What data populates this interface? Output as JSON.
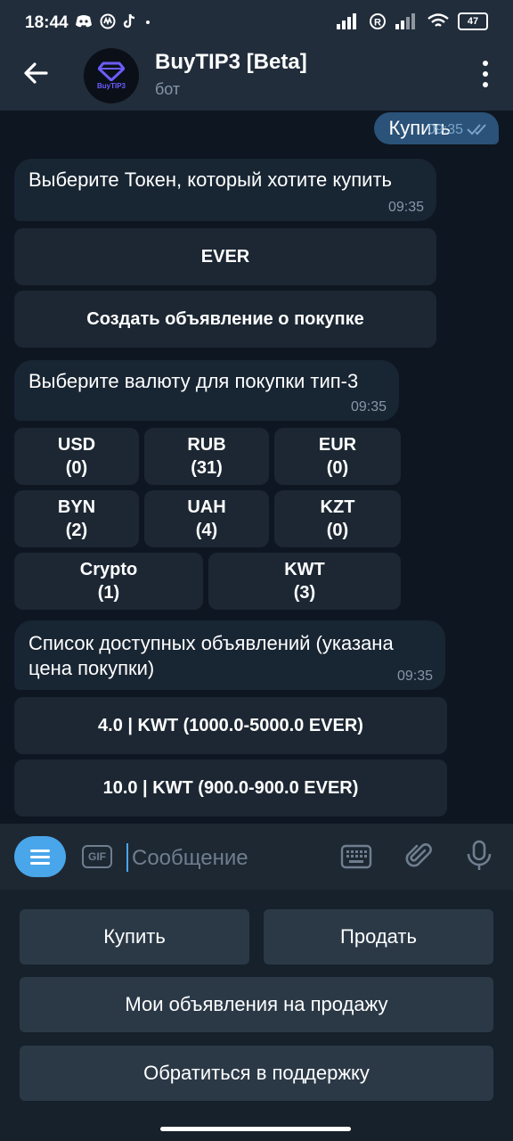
{
  "status": {
    "time": "18:44",
    "battery": "47"
  },
  "header": {
    "title": "BuyTIP3 [Beta]",
    "subtitle": "бот",
    "avatar_text": "BuyTIP3"
  },
  "messages": {
    "out1": {
      "text": "Купить",
      "time": "09:35"
    },
    "in1": {
      "text": "Выберите Токен, который хотите купить",
      "time": "09:35"
    },
    "kb1": [
      "EVER",
      "Создать объявление о покупке"
    ],
    "in2": {
      "text": "Выберите валюту для покупки тип-3",
      "time": "09:35"
    },
    "currencies": [
      {
        "code": "USD",
        "count": "(0)"
      },
      {
        "code": "RUB",
        "count": "(31)"
      },
      {
        "code": "EUR",
        "count": "(0)"
      },
      {
        "code": "BYN",
        "count": "(2)"
      },
      {
        "code": "UAH",
        "count": "(4)"
      },
      {
        "code": "KZT",
        "count": "(0)"
      },
      {
        "code": "Crypto",
        "count": "(1)"
      },
      {
        "code": "KWT",
        "count": "(3)"
      }
    ],
    "in3": {
      "text": "Список доступных объявлений (указана цена покупки)",
      "time": "09:35"
    },
    "offers": [
      "4.0 | KWT (1000.0-5000.0 EVER)",
      "10.0 | KWT (900.0-900.0 EVER)"
    ]
  },
  "input": {
    "placeholder": "Сообщение",
    "gif_label": "GIF"
  },
  "reply_keyboard": [
    "Купить",
    "Продать",
    "Мои объявления на продажу",
    "Обратиться в поддержку"
  ],
  "colors": {
    "bubble_in": "#182533",
    "bubble_out": "#2b5278",
    "accent": "#4aa6ea"
  }
}
